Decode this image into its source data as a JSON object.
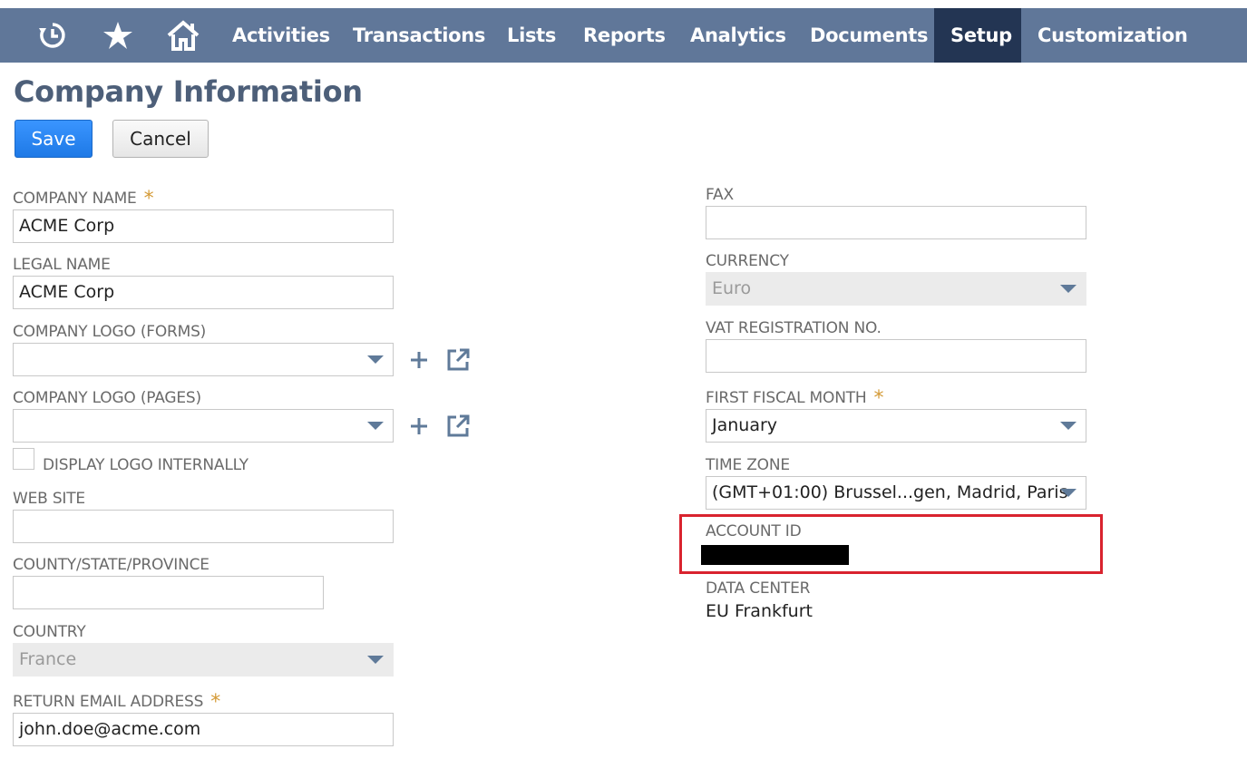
{
  "nav": {
    "icons": [
      "recent-history-icon",
      "star-icon",
      "home-icon"
    ],
    "items": [
      "Activities",
      "Transactions",
      "Lists",
      "Reports",
      "Analytics",
      "Documents",
      "Setup",
      "Customization"
    ],
    "active": "Setup",
    "bar_color": "#607799",
    "active_color": "#233553"
  },
  "page": {
    "title": "Company Information",
    "save_label": "Save",
    "cancel_label": "Cancel"
  },
  "left": {
    "company_name": {
      "label": "COMPANY NAME",
      "value": "ACME Corp",
      "required_mark": "*"
    },
    "legal_name": {
      "label": "LEGAL NAME",
      "value": "ACME Corp"
    },
    "logo_forms": {
      "label": "COMPANY LOGO (FORMS)",
      "value": ""
    },
    "logo_pages": {
      "label": "COMPANY LOGO (PAGES)",
      "value": ""
    },
    "display_logo": {
      "label": "DISPLAY LOGO INTERNALLY",
      "checked": false
    },
    "web_site": {
      "label": "WEB SITE",
      "value": ""
    },
    "county": {
      "label": "COUNTY/STATE/PROVINCE",
      "value": ""
    },
    "country": {
      "label": "COUNTRY",
      "value": "France"
    },
    "return_email": {
      "label": "RETURN EMAIL ADDRESS",
      "value": "john.doe@acme.com",
      "required_mark": "*"
    }
  },
  "right": {
    "fax": {
      "label": "FAX",
      "value": ""
    },
    "currency": {
      "label": "CURRENCY",
      "value": "Euro"
    },
    "vat": {
      "label": "VAT REGISTRATION NO.",
      "value": ""
    },
    "fiscal_month": {
      "label": "FIRST FISCAL MONTH",
      "value": "January",
      "required_mark": "*"
    },
    "time_zone": {
      "label": "TIME ZONE",
      "value": "(GMT+01:00) Brussel...gen, Madrid, Paris"
    },
    "account_id": {
      "label": "ACCOUNT ID"
    },
    "data_center": {
      "label": "DATA CENTER",
      "value": "EU Frankfurt"
    }
  },
  "colors": {
    "accent": "#1e79e6",
    "required": "#d49a36",
    "highlight": "#d9232e"
  }
}
